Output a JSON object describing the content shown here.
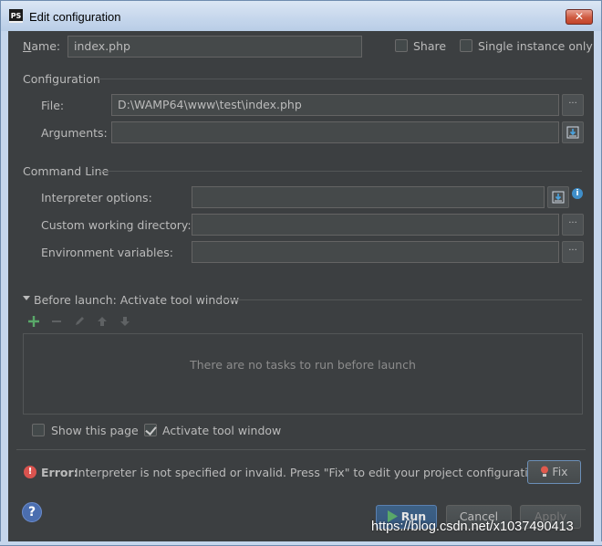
{
  "window": {
    "icon_text": "PS",
    "title": "Edit configuration",
    "close_glyph": "✕"
  },
  "name_row": {
    "label": "Name:",
    "value": "index.php",
    "share_label": "Share",
    "share_checked": false,
    "single_instance_label": "Single instance only",
    "single_instance_checked": false
  },
  "configuration": {
    "heading": "Configuration",
    "file_label": "File:",
    "file_value": "D:\\WAMP64\\www\\test\\index.php",
    "file_browse": "···",
    "arguments_label": "Arguments:",
    "arguments_value": ""
  },
  "command_line": {
    "heading": "Command Line",
    "interpreter_options_label": "Interpreter options:",
    "interpreter_options_value": "",
    "info_glyph": "i",
    "working_dir_label": "Custom working directory:",
    "working_dir_value": "",
    "working_dir_browse": "···",
    "env_vars_label": "Environment variables:",
    "env_vars_value": "",
    "env_vars_browse": "···"
  },
  "before_launch": {
    "heading": "Before launch: Activate tool window",
    "empty_text": "There are no tasks to run before launch",
    "show_page_label": "Show this page",
    "show_page_checked": false,
    "activate_tool_label": "Activate tool window",
    "activate_tool_checked": true
  },
  "error": {
    "icon_glyph": "!",
    "prefix": "Error:",
    "message": "Interpreter is not specified or invalid. Press \"Fix\" to edit your project configuration.",
    "fix_label": "Fix"
  },
  "footer": {
    "help_glyph": "?",
    "run_label": "Run",
    "cancel_label": "Cancel",
    "apply_label": "Apply"
  },
  "watermark": "https://blog.csdn.net/x1037490413",
  "colors": {
    "background": "#3c3f41",
    "field": "#45494a",
    "text": "#bbbbbb",
    "add_green": "#59a869",
    "error_red": "#d9534f",
    "default_button": "#365880"
  }
}
